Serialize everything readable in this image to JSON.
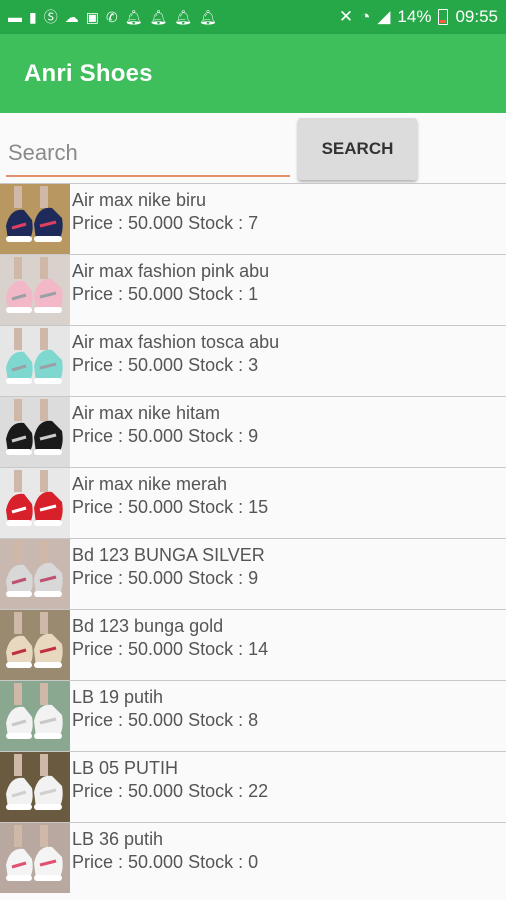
{
  "status_bar": {
    "battery_percent": "14%",
    "time": "09:55",
    "left_icons": [
      "message-icon",
      "sim-icon",
      "skype-icon",
      "cloud-icon",
      "image-icon",
      "whatsapp-icon",
      "bell-icon",
      "bell-icon",
      "bell-icon",
      "bell-icon"
    ],
    "right_icons": [
      "mute-icon",
      "wifi-icon",
      "signal-icon",
      "battery-icon"
    ]
  },
  "app_bar": {
    "title": "Anri Shoes"
  },
  "search": {
    "placeholder": "Search",
    "button_label": "SEARCH"
  },
  "colors": {
    "status_bar": "#26a748",
    "app_bar": "#3fbe5c",
    "search_underline": "#e0906a"
  },
  "products": [
    {
      "name": "Air max nike biru",
      "meta": "Price : 50.000 Stock : 7"
    },
    {
      "name": "Air max fashion pink abu",
      "meta": "Price : 50.000 Stock : 1"
    },
    {
      "name": "Air max fashion tosca abu",
      "meta": "Price : 50.000 Stock : 3"
    },
    {
      "name": "Air max nike hitam",
      "meta": "Price : 50.000 Stock : 9"
    },
    {
      "name": "Air max nike merah",
      "meta": "Price : 50.000 Stock : 15"
    },
    {
      "name": "Bd 123 BUNGA SILVER",
      "meta": "Price : 50.000 Stock : 9"
    },
    {
      "name": "Bd 123 bunga gold",
      "meta": "Price : 50.000 Stock : 14"
    },
    {
      "name": "LB 19 putih",
      "meta": "Price : 50.000 Stock : 8"
    },
    {
      "name": "LB 05 PUTIH",
      "meta": "Price : 50.000 Stock : 22"
    },
    {
      "name": "LB 36 putih",
      "meta": "Price : 50.000 Stock : 0"
    }
  ]
}
